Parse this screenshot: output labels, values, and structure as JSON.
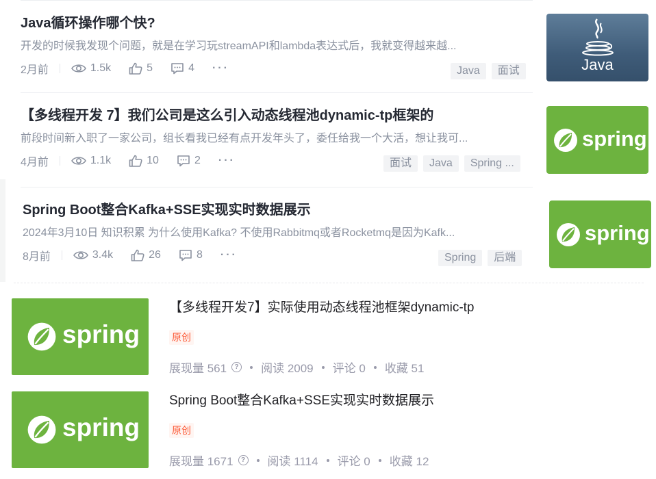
{
  "feed": {
    "entries": [
      {
        "title": "Java循环操作哪个快?",
        "abstract": "开发的时候我发现个问题，就是在学习玩streamAPI和lambda表达式后，我就变得越来越...",
        "time": "2月前",
        "views": "1.5k",
        "likes": "5",
        "comments": "4",
        "tags": [
          "Java",
          "面试"
        ],
        "thumb": "java",
        "thumb_label": "Java"
      },
      {
        "title": "【多线程开发 7】我们公司是这么引入动态线程池dynamic-tp框架的",
        "abstract": "前段时间新入职了一家公司，组长看我已经有点开发年头了，委任给我一个大活，想让我可...",
        "time": "4月前",
        "views": "1.1k",
        "likes": "10",
        "comments": "2",
        "tags": [
          "面试",
          "Java",
          "Spring ..."
        ],
        "thumb": "spring",
        "thumb_label": "spring"
      },
      {
        "title": "Spring Boot整合Kafka+SSE实现实时数据展示",
        "abstract": "2024年3月10日 知识积累 为什么使用Kafka?  不使用Rabbitmq或者Rocketmq是因为Kafk...",
        "time": "8月前",
        "views": "3.4k",
        "likes": "26",
        "comments": "8",
        "tags": [
          "Spring",
          "后端"
        ],
        "thumb": "spring",
        "thumb_label": "spring"
      }
    ]
  },
  "lower": {
    "items": [
      {
        "title": "【多线程开发7】实际使用动态线程池框架dynamic-tp",
        "badge": "原创",
        "impressions_label": "展现量 561",
        "reads_label": "阅读 2009",
        "comments_label": "评论 0",
        "favorites_label": "收藏 51",
        "thumb_label": "spring"
      },
      {
        "title": "Spring Boot整合Kafka+SSE实现实时数据展示",
        "badge": "原创",
        "impressions_label": "展现量 1671",
        "reads_label": "阅读 1114",
        "comments_label": "评论 0",
        "favorites_label": "收藏 12",
        "thumb_label": "spring"
      }
    ]
  },
  "colors": {
    "spring_green": "#6db33f",
    "badge_red": "#fc5531",
    "muted": "#8a919f"
  },
  "icons": [
    "eye-icon",
    "thumbs-up-icon",
    "comment-icon",
    "more-icon",
    "question-icon",
    "java-cup-icon",
    "spring-leaf-icon"
  ]
}
